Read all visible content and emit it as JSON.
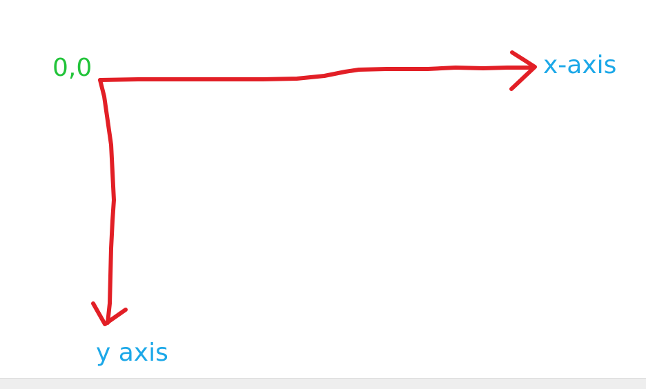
{
  "diagram": {
    "origin_label": "0,0",
    "x_axis_label": "x-axis",
    "y_axis_label": "y axis"
  },
  "colors": {
    "origin": "#22c43a",
    "axis_label": "#1ca8e8",
    "stroke": "#e21f26",
    "strip": "#eeeeee"
  }
}
